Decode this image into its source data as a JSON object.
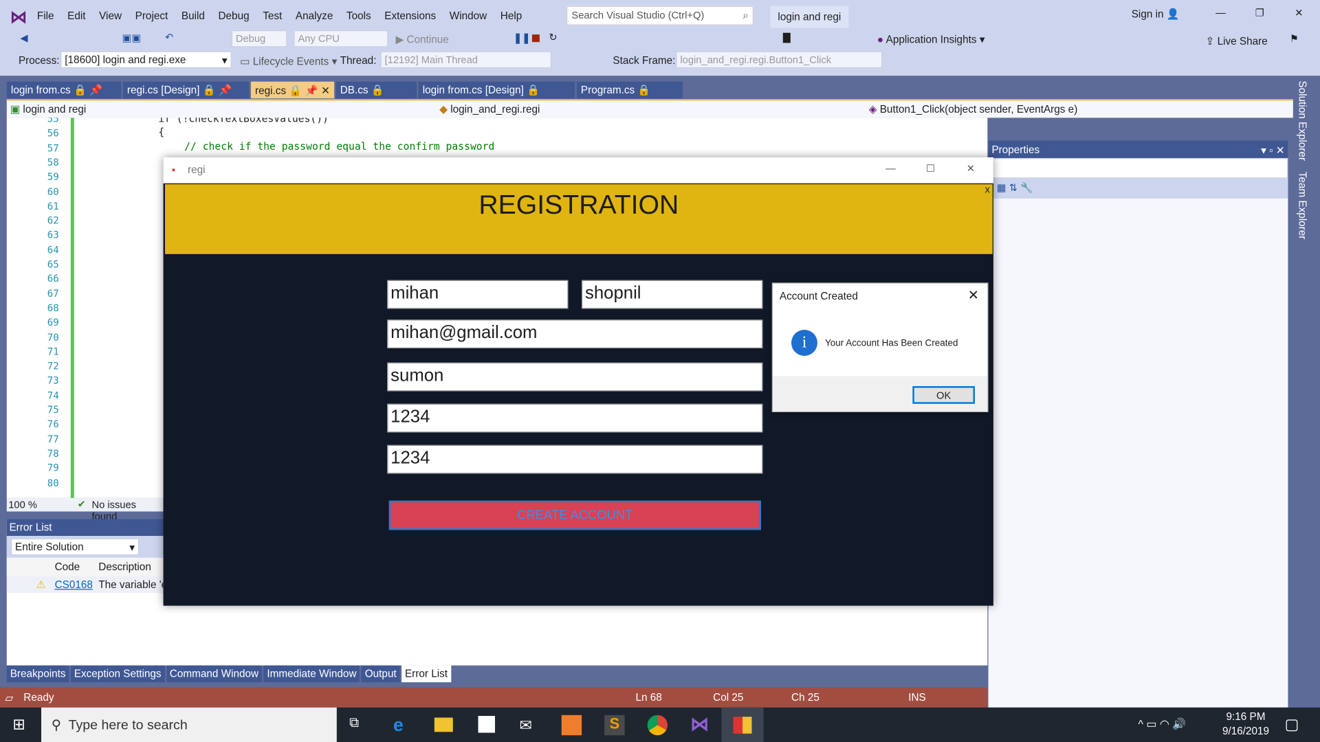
{
  "menu": [
    "File",
    "Edit",
    "View",
    "Project",
    "Build",
    "Debug",
    "Test",
    "Analyze",
    "Tools",
    "Extensions",
    "Window",
    "Help"
  ],
  "search_placeholder": "Search Visual Studio (Ctrl+Q)",
  "solution_name": "login and regi",
  "sign_in": "Sign in",
  "toolbar": {
    "config": "Debug",
    "platform": "Any CPU",
    "continue": "Continue",
    "app_insights": "Application Insights",
    "live_share": "Live Share"
  },
  "debugbar": {
    "process_label": "Process:",
    "process": "[18600] login and regi.exe",
    "lifecycle": "Lifecycle Events",
    "thread_label": "Thread:",
    "thread": "[12192] Main Thread",
    "stack_label": "Stack Frame:",
    "stack": "login_and_regi.regi.Button1_Click"
  },
  "tabs": [
    {
      "label": "login from.cs"
    },
    {
      "label": "regi.cs [Design]"
    },
    {
      "label": "regi.cs",
      "active": true
    },
    {
      "label": "DB.cs"
    },
    {
      "label": "login from.cs [Design]"
    },
    {
      "label": "Program.cs"
    }
  ],
  "nav": {
    "project": "login and regi",
    "class": "login_and_regi.regi",
    "member": "Button1_Click(object sender, EventArgs e)"
  },
  "code": {
    "line_numbers": [
      "55",
      "56",
      "57",
      "58",
      "59",
      "60",
      "61",
      "62",
      "63",
      "64",
      "65",
      "66",
      "67",
      "68",
      "69",
      "70",
      "71",
      "72",
      "73",
      "74",
      "75",
      "76",
      "77",
      "78",
      "79",
      "80"
    ],
    "line55": "if (!checkTextBoxesValues())",
    "line56": "{",
    "line57": "// check if the password equal the confirm password"
  },
  "editor_status": {
    "zoom": "100 %",
    "issues": "No issues found"
  },
  "error_list": {
    "title": "Error List",
    "scope": "Entire Solution",
    "columns": [
      "Code",
      "Description"
    ],
    "rows": [
      {
        "code": "CS0168",
        "description": "The variable 'e"
      }
    ]
  },
  "properties_title": "Properties",
  "side_tabs": [
    "Solution Explorer",
    "Team Explorer"
  ],
  "form": {
    "title": "regi",
    "heading": "REGISTRATION",
    "first_name": "mihan",
    "last_name": "shopnil",
    "email": "mihan@gmail.com",
    "username": "sumon",
    "password": "1234",
    "confirm_password": "1234",
    "button": "CREATE ACCOUNT",
    "banner_color": "#e0b512",
    "button_color": "#d94155"
  },
  "dialog": {
    "title": "Account Created",
    "message": "Your Account Has Been Created",
    "ok": "OK"
  },
  "bottom_tabs": [
    "Breakpoints",
    "Exception Settings",
    "Command Window",
    "Immediate Window",
    "Output",
    "Error List"
  ],
  "status": {
    "ready": "Ready",
    "ln": "Ln 68",
    "col": "Col 25",
    "ch": "Ch 25",
    "ins": "INS"
  },
  "taskbar": {
    "search": "Type here to search",
    "time": "9:16 PM",
    "date": "9/16/2019"
  }
}
